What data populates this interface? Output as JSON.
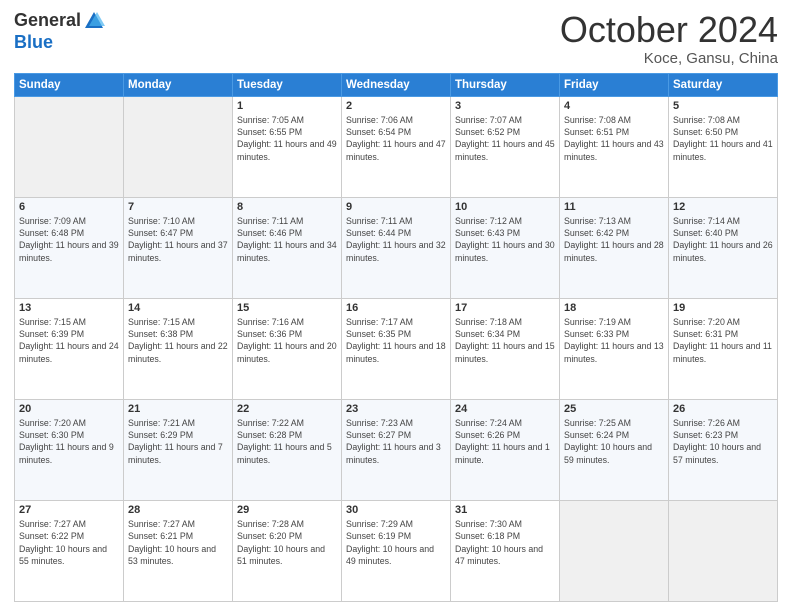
{
  "header": {
    "logo_general": "General",
    "logo_blue": "Blue",
    "month": "October 2024",
    "location": "Koce, Gansu, China"
  },
  "days_of_week": [
    "Sunday",
    "Monday",
    "Tuesday",
    "Wednesday",
    "Thursday",
    "Friday",
    "Saturday"
  ],
  "weeks": [
    [
      {
        "day": "",
        "info": ""
      },
      {
        "day": "",
        "info": ""
      },
      {
        "day": "1",
        "info": "Sunrise: 7:05 AM\nSunset: 6:55 PM\nDaylight: 11 hours and 49 minutes."
      },
      {
        "day": "2",
        "info": "Sunrise: 7:06 AM\nSunset: 6:54 PM\nDaylight: 11 hours and 47 minutes."
      },
      {
        "day": "3",
        "info": "Sunrise: 7:07 AM\nSunset: 6:52 PM\nDaylight: 11 hours and 45 minutes."
      },
      {
        "day": "4",
        "info": "Sunrise: 7:08 AM\nSunset: 6:51 PM\nDaylight: 11 hours and 43 minutes."
      },
      {
        "day": "5",
        "info": "Sunrise: 7:08 AM\nSunset: 6:50 PM\nDaylight: 11 hours and 41 minutes."
      }
    ],
    [
      {
        "day": "6",
        "info": "Sunrise: 7:09 AM\nSunset: 6:48 PM\nDaylight: 11 hours and 39 minutes."
      },
      {
        "day": "7",
        "info": "Sunrise: 7:10 AM\nSunset: 6:47 PM\nDaylight: 11 hours and 37 minutes."
      },
      {
        "day": "8",
        "info": "Sunrise: 7:11 AM\nSunset: 6:46 PM\nDaylight: 11 hours and 34 minutes."
      },
      {
        "day": "9",
        "info": "Sunrise: 7:11 AM\nSunset: 6:44 PM\nDaylight: 11 hours and 32 minutes."
      },
      {
        "day": "10",
        "info": "Sunrise: 7:12 AM\nSunset: 6:43 PM\nDaylight: 11 hours and 30 minutes."
      },
      {
        "day": "11",
        "info": "Sunrise: 7:13 AM\nSunset: 6:42 PM\nDaylight: 11 hours and 28 minutes."
      },
      {
        "day": "12",
        "info": "Sunrise: 7:14 AM\nSunset: 6:40 PM\nDaylight: 11 hours and 26 minutes."
      }
    ],
    [
      {
        "day": "13",
        "info": "Sunrise: 7:15 AM\nSunset: 6:39 PM\nDaylight: 11 hours and 24 minutes."
      },
      {
        "day": "14",
        "info": "Sunrise: 7:15 AM\nSunset: 6:38 PM\nDaylight: 11 hours and 22 minutes."
      },
      {
        "day": "15",
        "info": "Sunrise: 7:16 AM\nSunset: 6:36 PM\nDaylight: 11 hours and 20 minutes."
      },
      {
        "day": "16",
        "info": "Sunrise: 7:17 AM\nSunset: 6:35 PM\nDaylight: 11 hours and 18 minutes."
      },
      {
        "day": "17",
        "info": "Sunrise: 7:18 AM\nSunset: 6:34 PM\nDaylight: 11 hours and 15 minutes."
      },
      {
        "day": "18",
        "info": "Sunrise: 7:19 AM\nSunset: 6:33 PM\nDaylight: 11 hours and 13 minutes."
      },
      {
        "day": "19",
        "info": "Sunrise: 7:20 AM\nSunset: 6:31 PM\nDaylight: 11 hours and 11 minutes."
      }
    ],
    [
      {
        "day": "20",
        "info": "Sunrise: 7:20 AM\nSunset: 6:30 PM\nDaylight: 11 hours and 9 minutes."
      },
      {
        "day": "21",
        "info": "Sunrise: 7:21 AM\nSunset: 6:29 PM\nDaylight: 11 hours and 7 minutes."
      },
      {
        "day": "22",
        "info": "Sunrise: 7:22 AM\nSunset: 6:28 PM\nDaylight: 11 hours and 5 minutes."
      },
      {
        "day": "23",
        "info": "Sunrise: 7:23 AM\nSunset: 6:27 PM\nDaylight: 11 hours and 3 minutes."
      },
      {
        "day": "24",
        "info": "Sunrise: 7:24 AM\nSunset: 6:26 PM\nDaylight: 11 hours and 1 minute."
      },
      {
        "day": "25",
        "info": "Sunrise: 7:25 AM\nSunset: 6:24 PM\nDaylight: 10 hours and 59 minutes."
      },
      {
        "day": "26",
        "info": "Sunrise: 7:26 AM\nSunset: 6:23 PM\nDaylight: 10 hours and 57 minutes."
      }
    ],
    [
      {
        "day": "27",
        "info": "Sunrise: 7:27 AM\nSunset: 6:22 PM\nDaylight: 10 hours and 55 minutes."
      },
      {
        "day": "28",
        "info": "Sunrise: 7:27 AM\nSunset: 6:21 PM\nDaylight: 10 hours and 53 minutes."
      },
      {
        "day": "29",
        "info": "Sunrise: 7:28 AM\nSunset: 6:20 PM\nDaylight: 10 hours and 51 minutes."
      },
      {
        "day": "30",
        "info": "Sunrise: 7:29 AM\nSunset: 6:19 PM\nDaylight: 10 hours and 49 minutes."
      },
      {
        "day": "31",
        "info": "Sunrise: 7:30 AM\nSunset: 6:18 PM\nDaylight: 10 hours and 47 minutes."
      },
      {
        "day": "",
        "info": ""
      },
      {
        "day": "",
        "info": ""
      }
    ]
  ]
}
